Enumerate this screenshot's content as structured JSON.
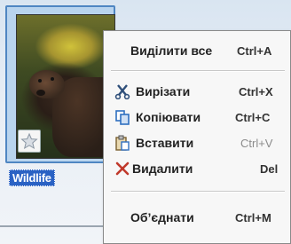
{
  "file": {
    "name": "Wildlife"
  },
  "menu": {
    "items": [
      {
        "label": "Виділити все",
        "shortcut": "Ctrl+A",
        "icon": "none"
      },
      {
        "label": "Вирізати",
        "shortcut": "Ctrl+X",
        "icon": "scissors-icon"
      },
      {
        "label": "Копіювати",
        "shortcut": "Ctrl+C",
        "icon": "copy-icon"
      },
      {
        "label": "Вставити",
        "shortcut": "Ctrl+V",
        "icon": "paste-icon",
        "disabled_shortcut": true
      },
      {
        "label": "Видалити",
        "shortcut": "Del",
        "icon": "delete-x-icon"
      },
      {
        "label": "Об’єднати",
        "shortcut": "Ctrl+M",
        "icon": "none"
      }
    ]
  },
  "colors": {
    "selection": "#2a62c4",
    "delete_icon": "#c0392b",
    "copy_icon": "#2f6fc0"
  }
}
